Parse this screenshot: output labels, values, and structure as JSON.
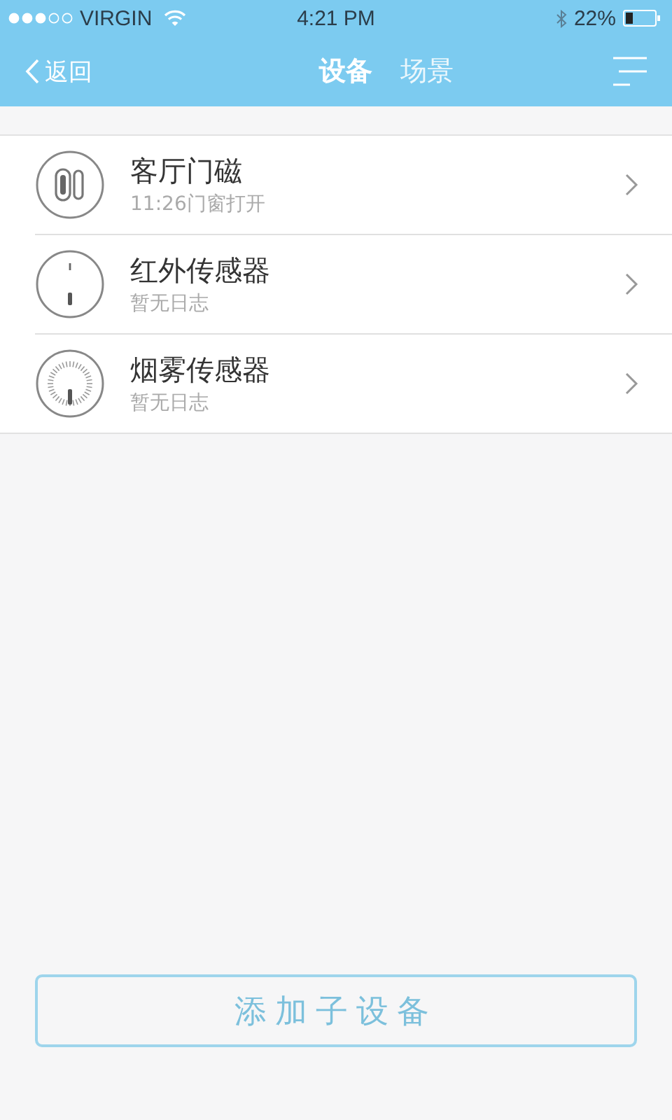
{
  "status_bar": {
    "carrier": "VIRGIN",
    "time": "4:21 PM",
    "battery": "22%"
  },
  "nav": {
    "back": "返回",
    "tabs": [
      {
        "label": "设备",
        "selected": true
      },
      {
        "label": "场景",
        "selected": false
      }
    ]
  },
  "devices": [
    {
      "kind": "door",
      "name": "客厅门磁",
      "status": "11:26门窗打开"
    },
    {
      "kind": "infrared",
      "name": "红外传感器",
      "status": "暂无日志"
    },
    {
      "kind": "smoke",
      "name": "烟雾传感器",
      "status": "暂无日志"
    }
  ],
  "add_button": "添加子设备"
}
